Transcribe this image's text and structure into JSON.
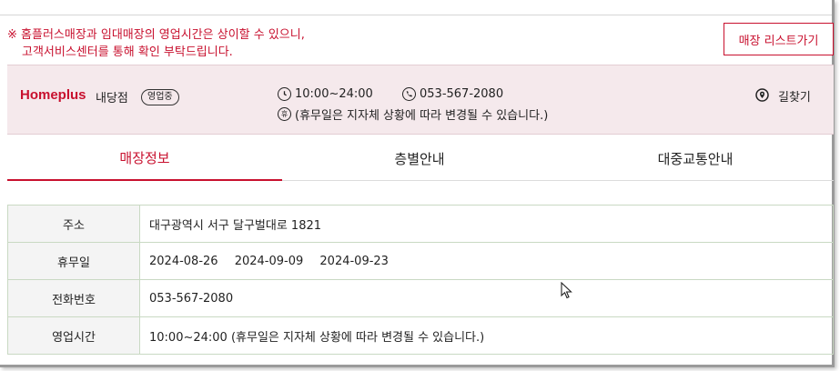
{
  "notice": {
    "line1": "※ 홈플러스매장과 임대매장의 영업시간은 상이할 수 있으니,",
    "line2": "고객서비스센터를 통해 확인 부탁드립니다."
  },
  "store_list_button": "매장 리스트가기",
  "store": {
    "brand": "Homeplus",
    "branch": "내당점",
    "status_badge": "영업중",
    "hours": "10:00~24:00",
    "phone": "053-567-2080",
    "holiday_icon_glyph": "휴",
    "holiday_note": "(휴무일은 지자체 상황에 따라 변경될 수 있습니다.)",
    "directions": "길찾기"
  },
  "tabs": [
    {
      "label": "매장정보",
      "active": true
    },
    {
      "label": "층별안내",
      "active": false
    },
    {
      "label": "대중교통안내",
      "active": false
    }
  ],
  "info_table": {
    "rows": [
      {
        "label": "주소",
        "value": "대구광역시 서구 달구벌대로 1821"
      },
      {
        "label": "휴무일",
        "dates": [
          "2024-08-26",
          "2024-09-09",
          "2024-09-23"
        ]
      },
      {
        "label": "전화번호",
        "value": "053-567-2080"
      },
      {
        "label": "영업시간",
        "value": "10:00~24:00 (휴무일은 지자체 상황에 따라 변경될 수 있습니다.)"
      }
    ]
  },
  "colors": {
    "accent": "#c8102e",
    "store_bar_bg": "#f5e9ec",
    "table_border": "#c9d9c3"
  },
  "icons": [
    "clock-icon",
    "phone-icon",
    "holiday-icon",
    "location-pin-icon",
    "mouse-cursor-icon"
  ]
}
